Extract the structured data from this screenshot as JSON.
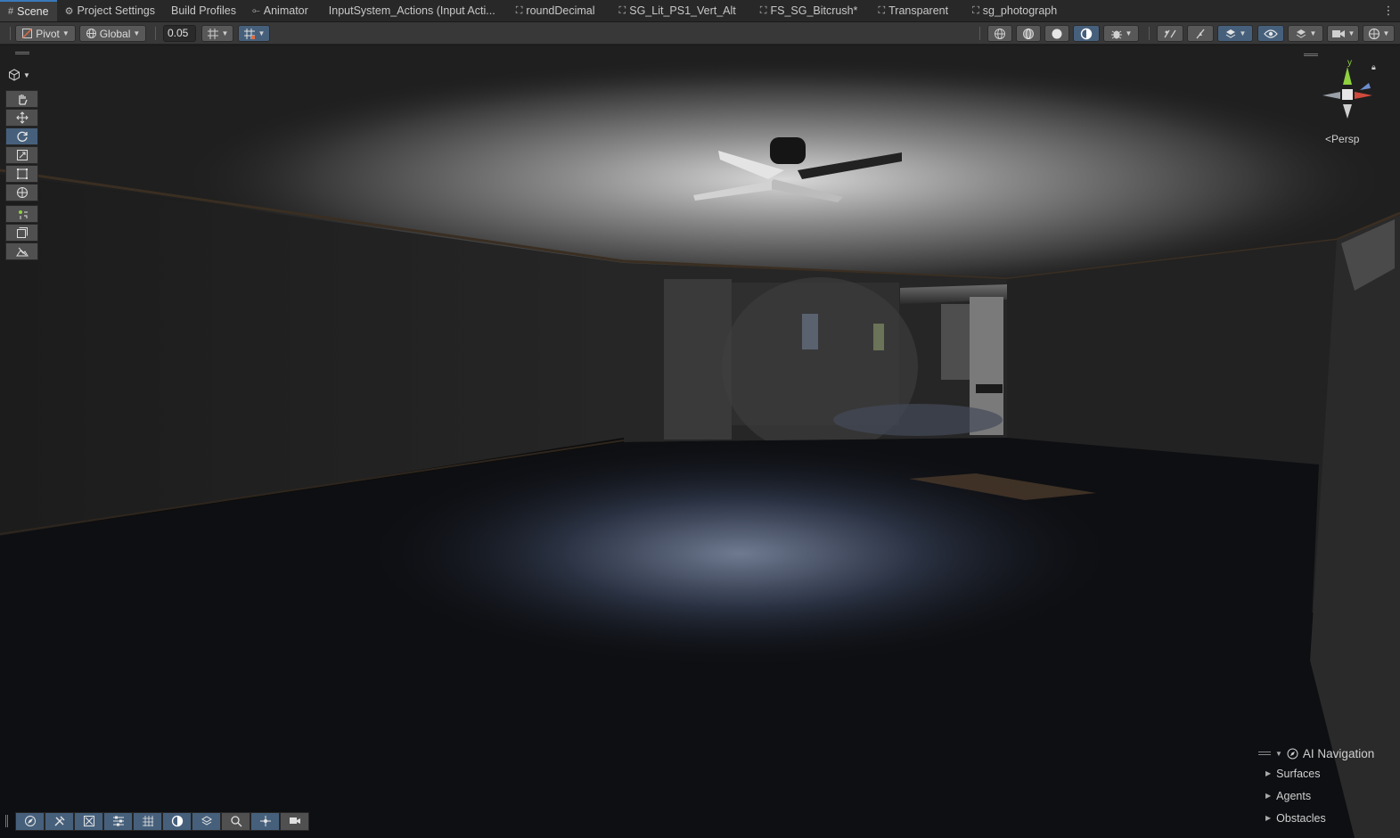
{
  "tabs": [
    {
      "label": "Scene",
      "icon": "scene-grid-icon",
      "active": true
    },
    {
      "label": "Project Settings",
      "icon": "gear-icon"
    },
    {
      "label": "Build Profiles",
      "icon": ""
    },
    {
      "label": "Animator",
      "icon": "animator-icon"
    },
    {
      "label": "InputSystem_Actions (Input Acti...",
      "icon": ""
    },
    {
      "label": "roundDecimal",
      "icon": "shader-graph-icon"
    },
    {
      "label": "SG_Lit_PS1_Vert_Alt",
      "icon": "shader-graph-icon"
    },
    {
      "label": "FS_SG_Bitcrush*",
      "icon": "shader-graph-icon"
    },
    {
      "label": "Transparent",
      "icon": "shader-graph-icon"
    },
    {
      "label": "sg_photograph",
      "icon": "shader-graph-icon"
    }
  ],
  "toolbar": {
    "pivot_label": "Pivot",
    "global_label": "Global",
    "snap_value": "0.05"
  },
  "viewport": {
    "persp_label": "Persp",
    "axis_y_label": "y"
  },
  "ai_navigation": {
    "title": "AI Navigation",
    "items": [
      "Surfaces",
      "Agents",
      "Obstacles"
    ]
  },
  "colors": {
    "accent_active": "#46607c",
    "tab_highlight": "#3a79bb",
    "axis_y": "#8fd13f",
    "axis_x": "#d04a3c"
  }
}
